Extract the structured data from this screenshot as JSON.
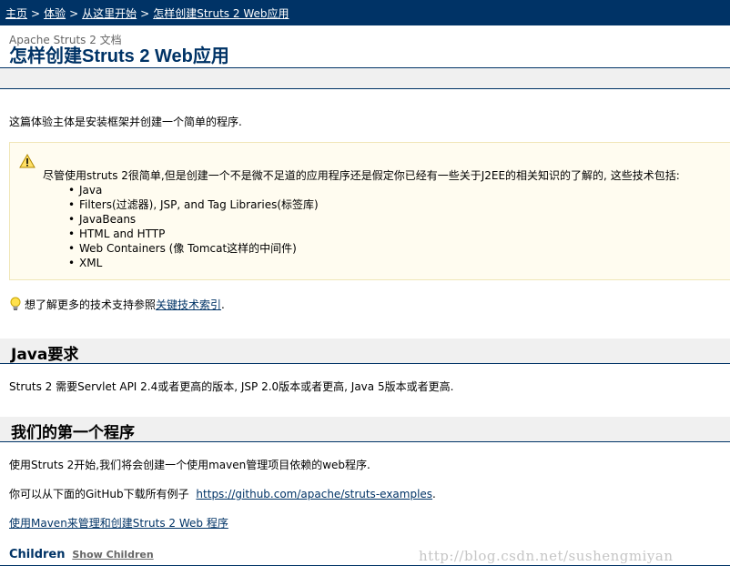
{
  "breadcrumb": {
    "items": [
      "主页",
      "体验",
      "从这里开始",
      "怎样创建Struts 2 Web应用"
    ],
    "separator": ">"
  },
  "header": {
    "subtitle": "Apache Struts 2 文档",
    "title": "怎样创建Struts 2 Web应用"
  },
  "intro": "这篇体验主体是安装框架并创建一个简单的程序.",
  "warning": {
    "lead": "尽管使用struts 2很简单,但是创建一个不是微不足道的应用程序还是假定你已经有一些关于J2EE的相关知识的了解的, 这些技术包括:",
    "items": [
      "Java",
      "Filters(过滤器), JSP, and Tag Libraries(标签库)",
      "JavaBeans",
      "HTML and HTTP",
      "Web Containers (像 Tomcat这样的中间件)",
      "XML"
    ]
  },
  "tip": {
    "text": "想了解更多的技术支持参照",
    "link": "关键技术索引",
    "suffix": "."
  },
  "java_section": {
    "heading": "Java要求",
    "body": "Struts 2 需要Servlet API 2.4或者更高的版本, JSP 2.0版本或者更高, Java 5版本或者更高."
  },
  "first_app": {
    "heading": "我们的第一个程序",
    "p1": "使用Struts 2开始,我们将会创建一个使用maven管理项目依赖的web程序.",
    "p2_text": "你可以从下面的GitHub下载所有例子",
    "p2_link": "https://github.com/apache/struts-examples",
    "p2_suffix": ".",
    "link3": "使用Maven来管理和创建Struts 2 Web 程序"
  },
  "children": {
    "label": "Children",
    "link": "Show Children"
  },
  "watermark": "http://blog.csdn.net/sushengmiyan",
  "colors": {
    "header_bar": "#003366",
    "title": "#003366",
    "warning_bg": "#fffcf0",
    "section_bg": "#f0f0f0"
  }
}
